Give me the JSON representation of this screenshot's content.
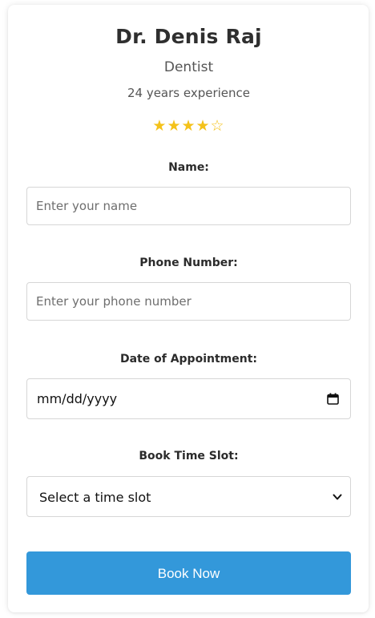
{
  "doctor": {
    "name": "Dr. Denis Raj",
    "specialty": "Dentist",
    "experience": "24 years experience",
    "rating_stars": "★★★★☆",
    "rating": 4,
    "rating_max": 5,
    "star_color": "#f4c21a"
  },
  "form": {
    "name": {
      "label": "Name:",
      "placeholder": "Enter your name",
      "value": ""
    },
    "phone": {
      "label": "Phone Number:",
      "placeholder": "Enter your phone number",
      "value": ""
    },
    "date": {
      "label": "Date of Appointment:",
      "display": "mm/dd/yyyy",
      "icon": "calendar-icon"
    },
    "time_slot": {
      "label": "Book Time Slot:",
      "selected": "Select a time slot",
      "icon": "chevron-down-icon"
    },
    "submit": {
      "label": "Book Now",
      "color": "#3398da"
    }
  }
}
